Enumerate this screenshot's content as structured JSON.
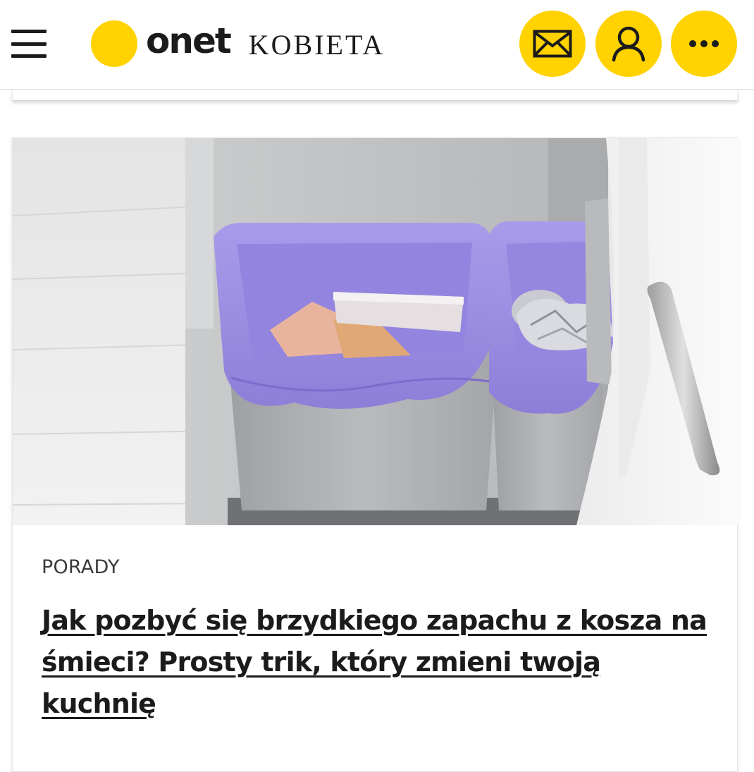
{
  "header": {
    "logo_word": "onet",
    "section_name": "KOBIETA",
    "buttons": [
      {
        "name": "mail",
        "icon": "envelope-icon"
      },
      {
        "name": "account",
        "icon": "user-icon"
      },
      {
        "name": "more",
        "icon": "more-dots-icon"
      }
    ]
  },
  "article": {
    "image_description_icon": "trash-bins-photo",
    "category": "PORADY",
    "title": "Jak pozbyć się brzydkiego zapachu z kosza na śmieci? Prosty trik, który zmieni twoją kuchnię"
  },
  "colors": {
    "brand_yellow": "#ffd200",
    "text_dark": "#1b1b1b",
    "category_gray": "#3a3a3a"
  }
}
